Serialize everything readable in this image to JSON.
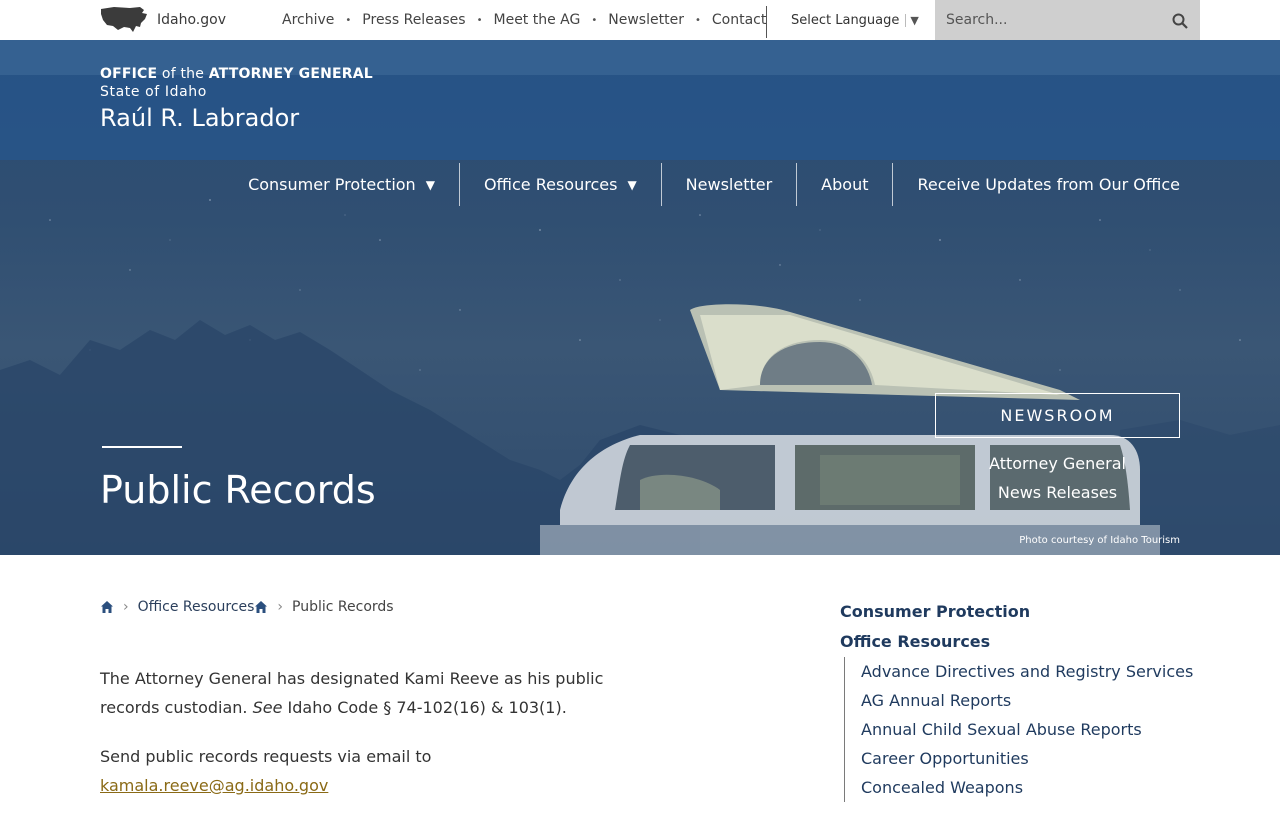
{
  "topbar": {
    "site_label": "Idaho.gov",
    "links": [
      "Archive",
      "Press Releases",
      "Meet the AG",
      "Newsletter",
      "Contact"
    ],
    "separator": "•",
    "language_label": "Select Language",
    "search_placeholder": "Search..."
  },
  "header": {
    "office_word": "OFFICE",
    "of_the": " of the ",
    "ag_word": "ATTORNEY GENERAL",
    "state": "State of Idaho",
    "name": "Raúl R. Labrador"
  },
  "main_nav": {
    "items": [
      {
        "label": "Consumer Protection",
        "dropdown": true
      },
      {
        "label": "Office Resources",
        "dropdown": true
      },
      {
        "label": "Newsletter",
        "dropdown": false
      },
      {
        "label": "About",
        "dropdown": false
      },
      {
        "label": "Receive Updates from Our Office",
        "dropdown": false
      }
    ],
    "dropdown_glyph": "▼"
  },
  "hero": {
    "page_title": "Public Records",
    "newsroom_button": "NEWSROOM",
    "newsroom_line1": "Attorney General",
    "newsroom_line2": "News Releases",
    "photo_credit": "Photo courtesy of Idaho Tourism"
  },
  "breadcrumb": {
    "items": [
      "Office Resources",
      "Public Records"
    ]
  },
  "content": {
    "p1_a": "The Attorney General has designated Kami Reeve as his public records custodian.  ",
    "p1_see": "See",
    "p1_b": " Idaho Code § 74-102(16) & 103(1).",
    "p2_text": "Send public records requests via email to ",
    "p2_email": "kamala.reeve@ag.idaho.gov"
  },
  "sidebar": {
    "sections": [
      "Consumer Protection",
      "Office Resources"
    ],
    "office_resources_items": [
      "Advance Directives and Registry Services",
      "AG Annual Reports",
      "Annual Child Sexual Abuse Reports",
      "Career Opportunities",
      "Concealed Weapons"
    ]
  },
  "colors": {
    "header_band": "#26568c",
    "link_gold": "#8a6a16",
    "sidebar_blue": "#1f3a5e"
  }
}
